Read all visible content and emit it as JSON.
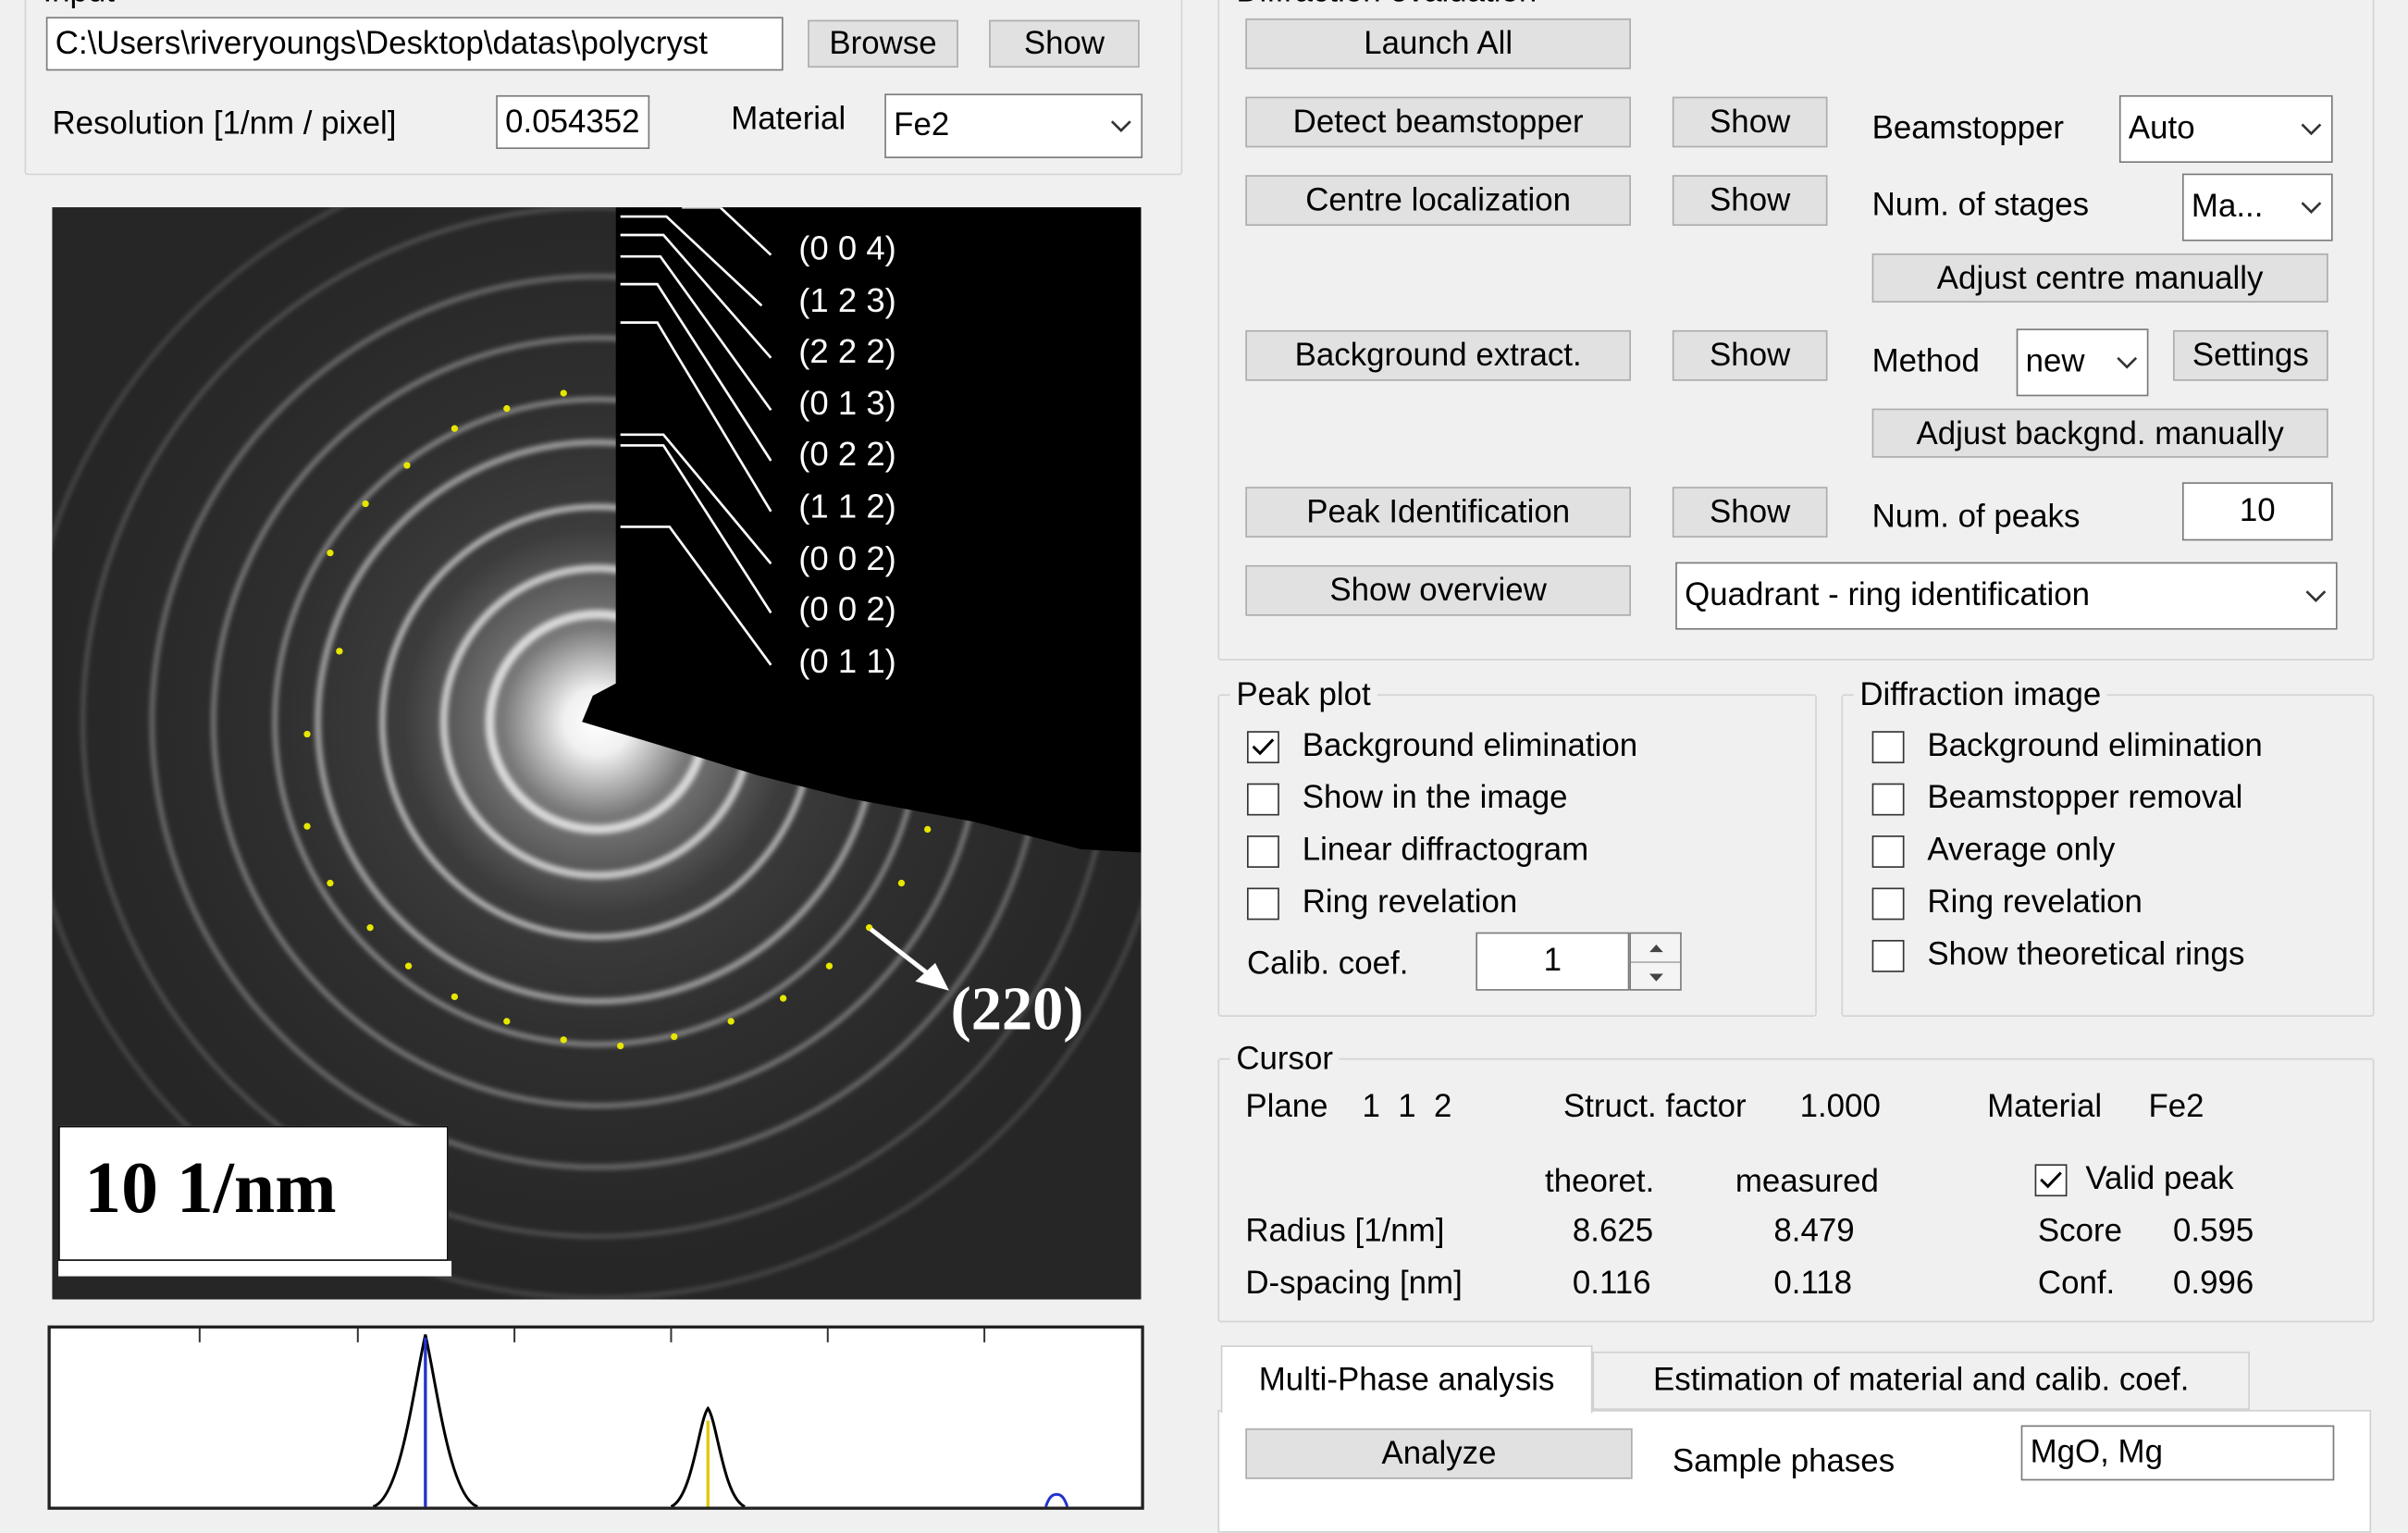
{
  "input": {
    "title": "Input",
    "path_value": "C:\\Users\\riveryoungs\\Desktop\\datas\\polycryst",
    "browse_label": "Browse",
    "show_label": "Show",
    "resolution_label": "Resolution [1/nm / pixel]",
    "resolution_value": "0.054352",
    "material_label": "Material",
    "material_value": "Fe2"
  },
  "image": {
    "hkl_labels": [
      "(0  0  4)",
      "(1  2  3)",
      "(2  2  2)",
      "(0  1  3)",
      "(0  2  2)",
      "(1  1  2)",
      "(0  0  2)",
      "(0  0  2)",
      "(0  1  1)"
    ],
    "ring_label": "(220)",
    "scale_bar": "10 1/nm"
  },
  "diffraction_evaluation": {
    "title": "Diffraction evaluation",
    "launch_all": "Launch All",
    "detect_beamstopper": "Detect beamstopper",
    "centre_localization": "Centre localization",
    "background_extract": "Background extract.",
    "peak_identification": "Peak Identification",
    "show_overview": "Show overview",
    "show_label": "Show",
    "beamstopper_label": "Beamstopper",
    "beamstopper_value": "Auto",
    "stages_label": "Num. of stages",
    "stages_value": "Ma...",
    "adjust_centre": "Adjust centre manually",
    "method_label": "Method",
    "method_value": "new",
    "settings_label": "Settings",
    "adjust_background": "Adjust backgnd. manually",
    "peaks_label": "Num. of peaks",
    "peaks_value": "10",
    "overview_value": "Quadrant - ring identification"
  },
  "peak_plot": {
    "title": "Peak plot",
    "options": [
      {
        "label": "Background elimination",
        "checked": true
      },
      {
        "label": "Show in the image",
        "checked": false
      },
      {
        "label": "Linear diffractogram",
        "checked": false
      },
      {
        "label": "Ring revelation",
        "checked": false
      }
    ],
    "calib_label": "Calib. coef.",
    "calib_value": "1"
  },
  "diffraction_image": {
    "title": "Diffraction image",
    "options": [
      {
        "label": "Background elimination",
        "checked": false
      },
      {
        "label": "Beamstopper removal",
        "checked": false
      },
      {
        "label": "Average only",
        "checked": false
      },
      {
        "label": "Ring revelation",
        "checked": false
      },
      {
        "label": "Show theoretical rings",
        "checked": false
      }
    ]
  },
  "cursor": {
    "title": "Cursor",
    "plane_label": "Plane",
    "plane_value": "1  1  2",
    "struct_label": "Struct. factor",
    "struct_value": "1.000",
    "material_label": "Material",
    "material_value": "Fe2",
    "theoret_label": "theoret.",
    "measured_label": "measured",
    "valid_label": "Valid peak",
    "valid_checked": true,
    "radius_label": "Radius [1/nm]",
    "radius_theoret": "8.625",
    "radius_measured": "8.479",
    "score_label": "Score",
    "score_value": "0.595",
    "dspacing_label": "D-spacing [nm]",
    "dspacing_theoret": "0.116",
    "dspacing_measured": "0.118",
    "conf_label": "Conf.",
    "conf_value": "0.996"
  },
  "tabs": {
    "multiphase": "Multi-Phase analysis",
    "estimation": "Estimation of material and calib. coef.",
    "analyze": "Analyze",
    "sample_phases_label": "Sample phases",
    "sample_phases_value": "MgO, Mg"
  },
  "colors": {
    "peak_curve": "#000000",
    "marker_blue": "#2233cc",
    "marker_yellow": "#e0c800",
    "ring_dots": "#e6e600"
  }
}
